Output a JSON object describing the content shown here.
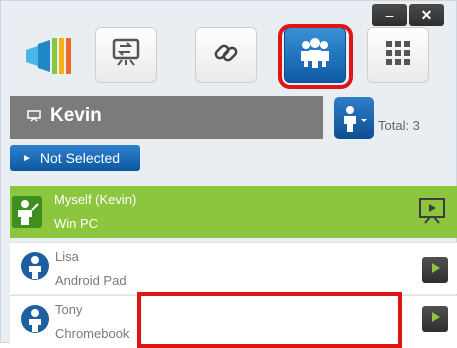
{
  "window": {
    "minimize_label": "–",
    "close_label": "✕"
  },
  "header": {
    "presenter_name": "Kevin",
    "total_label": "Total: 3"
  },
  "filter": {
    "button_label": "Not Selected",
    "arrow": "►"
  },
  "devices": [
    {
      "name": "Myself (Kevin)",
      "device": "Win PC"
    },
    {
      "name": "Lisa",
      "device": "Android Pad"
    },
    {
      "name": "Tony",
      "device": "Chromebook"
    }
  ],
  "colors": {
    "accent_blue": "#0c5aa4",
    "self_row_green": "#8cc63f",
    "highlight_red": "#e01515"
  },
  "icons": {
    "logo": "app-logo",
    "toolbar": [
      "screen-share-icon",
      "link-icon",
      "group-icon",
      "grid-icon"
    ],
    "presenter": "presenter-icon",
    "play": "play-icon"
  }
}
